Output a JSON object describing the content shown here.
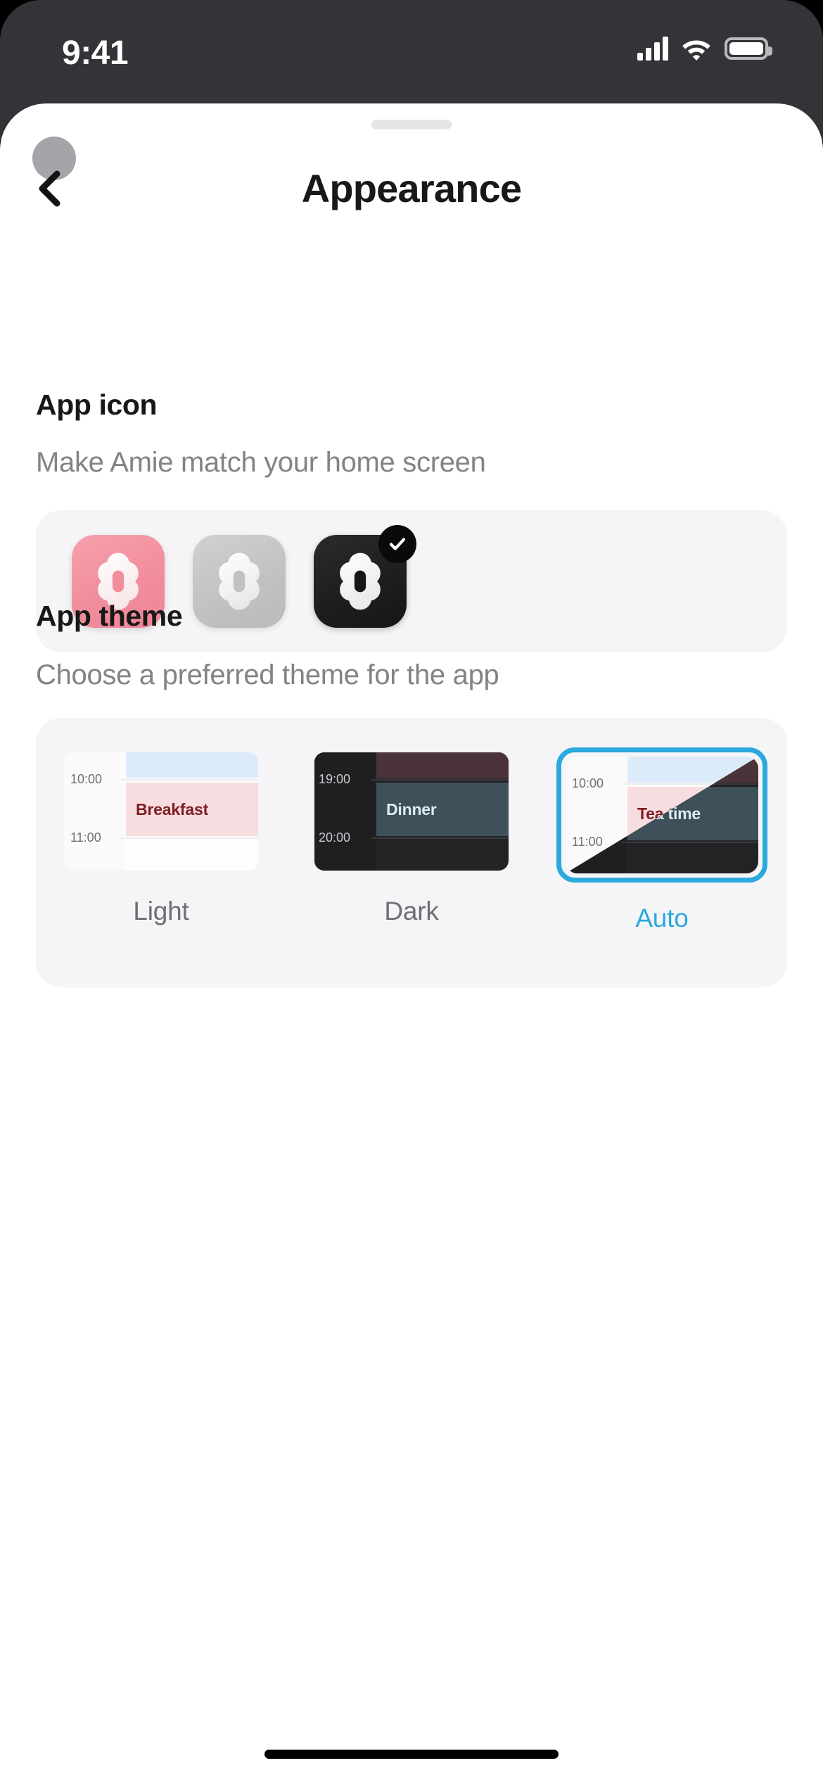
{
  "status_bar": {
    "time": "9:41",
    "cellular_icon": "cellular-signal-icon",
    "wifi_icon": "wifi-icon",
    "battery_icon": "battery-full-icon"
  },
  "nav": {
    "title": "Appearance",
    "back_icon": "chevron-left-icon",
    "avatar": "user-avatar"
  },
  "sections": {
    "app_icon": {
      "title": "App icon",
      "subtitle": "Make Amie match your home screen",
      "options": [
        {
          "name": "pink",
          "label": "Pink app icon",
          "bg": "#f18e9e",
          "selected": false
        },
        {
          "name": "grey",
          "label": "Grey app icon",
          "bg": "#c3c1bf",
          "selected": false
        },
        {
          "name": "dark",
          "label": "Dark app icon",
          "bg": "#1d1d1d",
          "selected": true
        }
      ],
      "selected_badge_icon": "check-icon"
    },
    "app_theme": {
      "title": "App theme",
      "subtitle": "Choose a preferred theme for the app",
      "selected": "Auto",
      "accent_color": "#2ba9dc",
      "options": [
        {
          "label": "Light",
          "selected": false,
          "preview": {
            "time_top": "10:00",
            "time_bottom": "11:00",
            "event_title": "Breakfast",
            "event_bg": "#f8dde0",
            "event_text_color": "#7e1e21",
            "accent_block_color": "#dcebfa"
          }
        },
        {
          "label": "Dark",
          "selected": false,
          "preview": {
            "time_top": "19:00",
            "time_bottom": "20:00",
            "event_title": "Dinner",
            "event_bg": "#3e5059",
            "event_text_color": "#dceaf2",
            "accent_block_color": "#4a3339"
          }
        },
        {
          "label": "Auto",
          "selected": true,
          "preview": {
            "time_top": "10:00",
            "time_bottom": "11:00",
            "event_title": "Tea time",
            "event_bg": "#f8dde0",
            "event_text_color": "#7e1e21",
            "accent_block_color": "#dcebfa"
          }
        }
      ]
    }
  },
  "home_indicator": "home-indicator"
}
